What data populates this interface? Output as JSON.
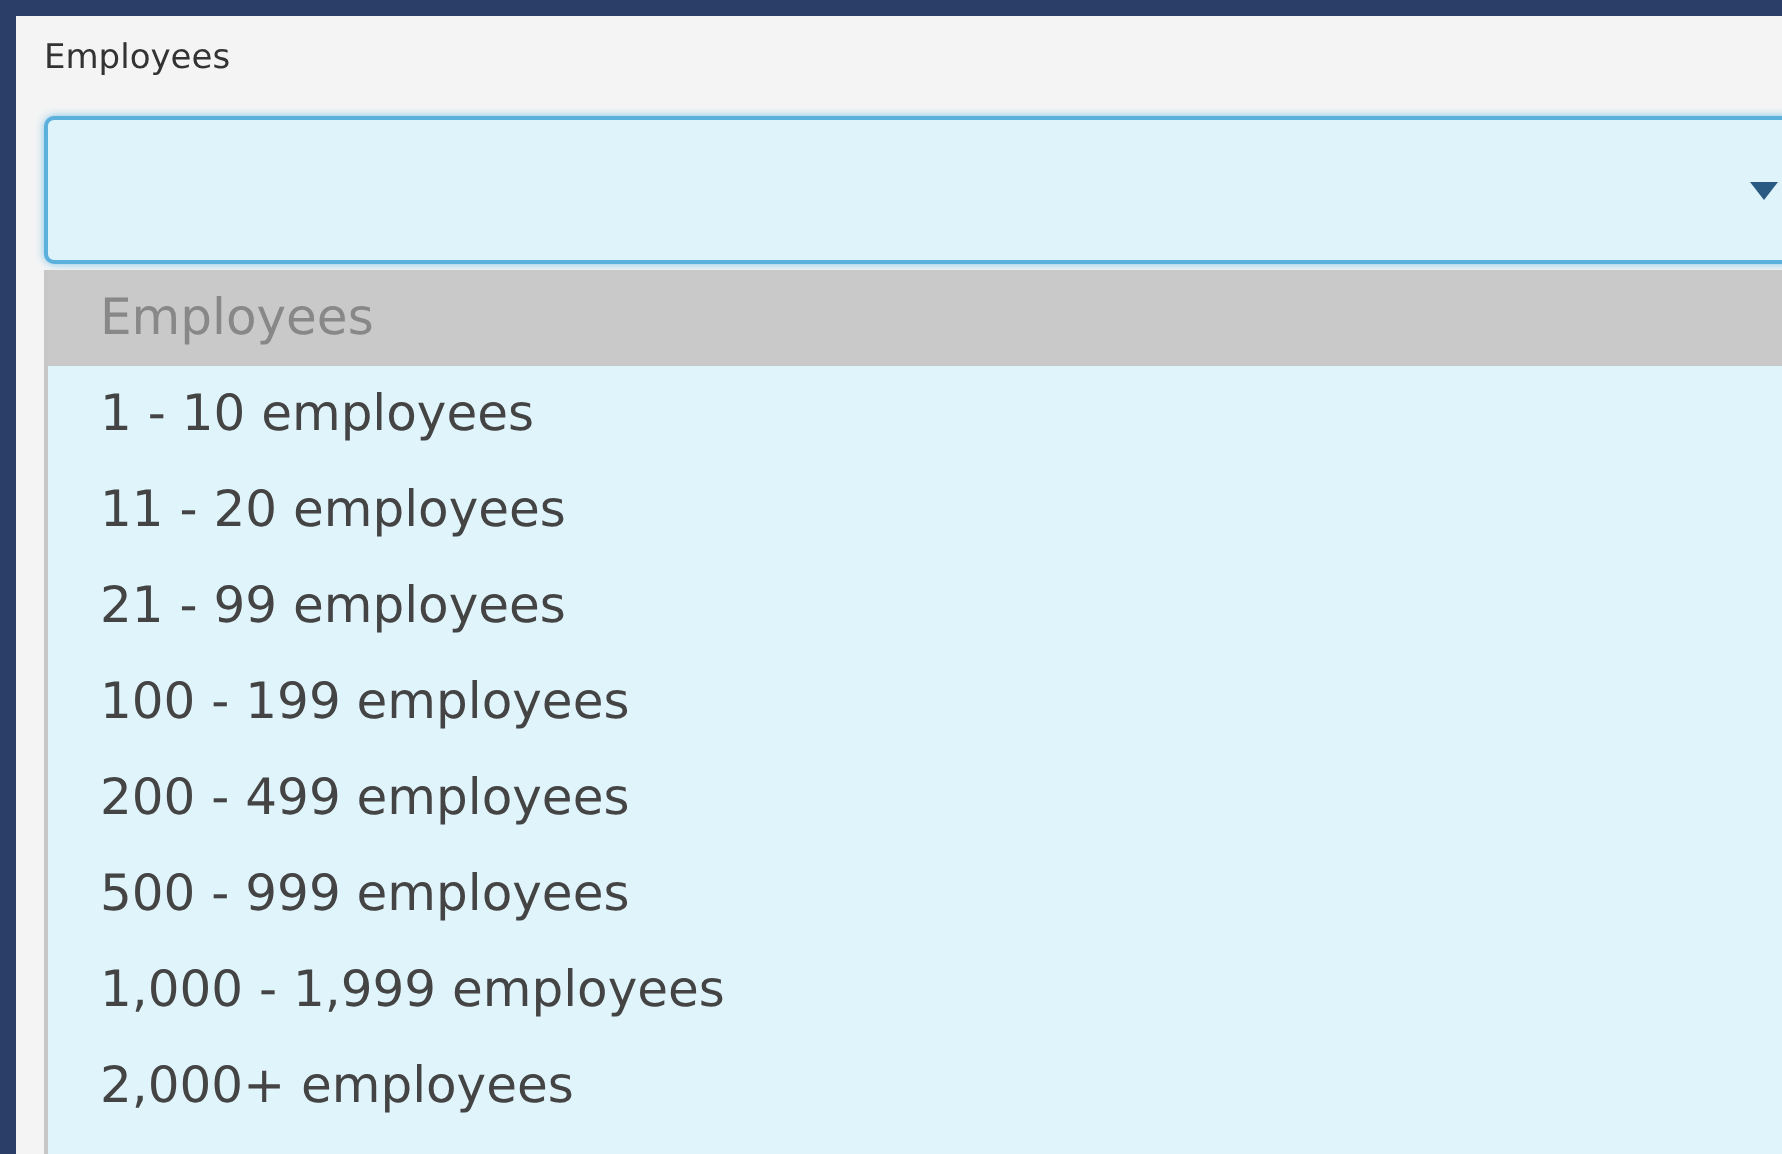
{
  "field": {
    "label": "Employees",
    "expanded": true
  },
  "options": [
    {
      "label": "Employees",
      "kind": "placeholder",
      "selected": true
    },
    {
      "label": "1 - 10 employees",
      "kind": "option",
      "selected": false
    },
    {
      "label": "11 - 20 employees",
      "kind": "option",
      "selected": false
    },
    {
      "label": "21 - 99 employees",
      "kind": "option",
      "selected": false
    },
    {
      "label": "100 - 199 employees",
      "kind": "option",
      "selected": false
    },
    {
      "label": "200 - 499 employees",
      "kind": "option",
      "selected": false
    },
    {
      "label": "500 - 999 employees",
      "kind": "option",
      "selected": false
    },
    {
      "label": "1,000 - 1,999 employees",
      "kind": "option",
      "selected": false
    },
    {
      "label": "2,000+ employees",
      "kind": "option",
      "selected": false
    }
  ]
}
